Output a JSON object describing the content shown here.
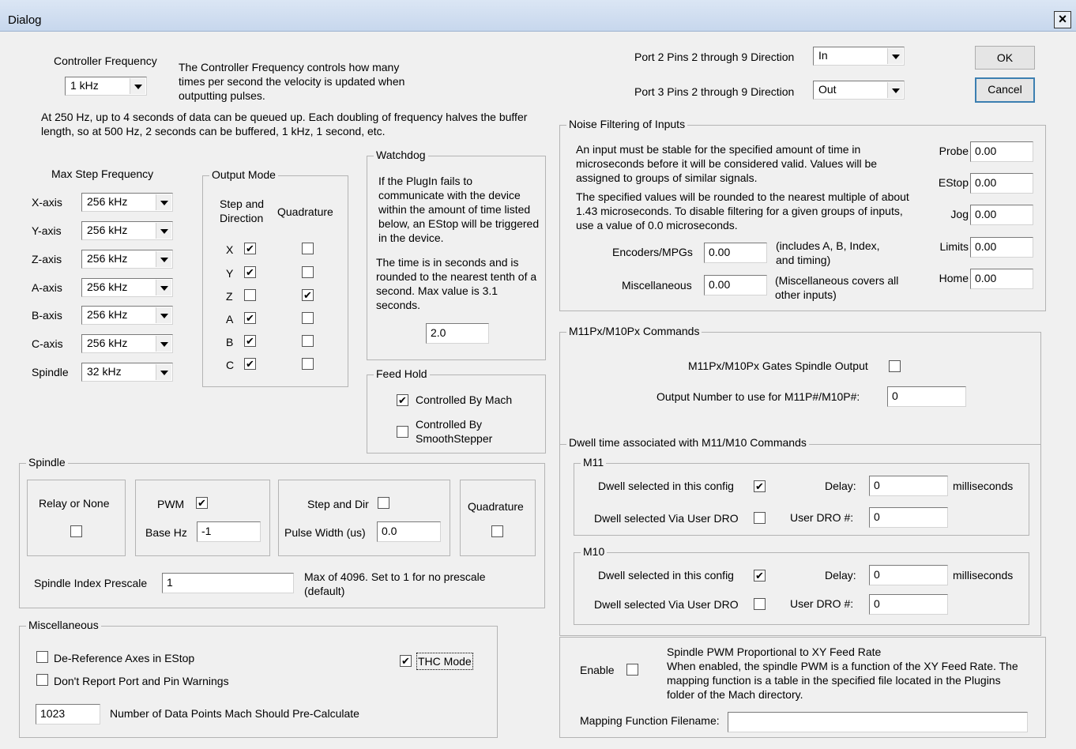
{
  "window": {
    "title": "Dialog",
    "close_glyph": "×"
  },
  "buttons": {
    "ok": "OK",
    "cancel": "Cancel"
  },
  "ports": {
    "port2_label": "Port 2 Pins 2 through 9 Direction",
    "port2_value": "In",
    "port3_label": "Port 3 Pins 2 through 9 Direction",
    "port3_value": "Out"
  },
  "controller": {
    "label": "Controller Frequency",
    "value": "1 kHz",
    "desc": "The Controller Frequency controls how many times per second the velocity is updated when outputting pulses.",
    "buffer_note": "At 250 Hz, up to 4 seconds of data can be queued up.  Each doubling of frequency halves the buffer length, so at 500 Hz, 2 seconds can be buffered, 1 kHz, 1 second, etc."
  },
  "max_step": {
    "label": "Max Step Frequency",
    "axes": [
      {
        "name": "X-axis",
        "value": "256 kHz"
      },
      {
        "name": "Y-axis",
        "value": "256 kHz"
      },
      {
        "name": "Z-axis",
        "value": "256 kHz"
      },
      {
        "name": "A-axis",
        "value": "256 kHz"
      },
      {
        "name": "B-axis",
        "value": "256 kHz"
      },
      {
        "name": "C-axis",
        "value": "256 kHz"
      },
      {
        "name": "Spindle",
        "value": "32 kHz"
      }
    ]
  },
  "output_mode": {
    "title": "Output Mode",
    "step_dir_label": "Step and Direction",
    "quadrature_label": "Quadrature",
    "rows": [
      {
        "axis": "X",
        "step": "✔",
        "quad": ""
      },
      {
        "axis": "Y",
        "step": "✔",
        "quad": ""
      },
      {
        "axis": "Z",
        "step": "",
        "quad": "✔"
      },
      {
        "axis": "A",
        "step": "✔",
        "quad": ""
      },
      {
        "axis": "B",
        "step": "✔",
        "quad": ""
      },
      {
        "axis": "C",
        "step": "✔",
        "quad": ""
      }
    ]
  },
  "watchdog": {
    "title": "Watchdog",
    "desc1": "If the PlugIn fails to communicate with the device within the amount of time listed below, an EStop will be triggered in the device.",
    "desc2": "The time is in seconds and is rounded to the nearest tenth of a second.  Max value is 3.1 seconds.",
    "value": "2.0"
  },
  "feed_hold": {
    "title": "Feed Hold",
    "mach_label": "Controlled By Mach",
    "mach_checked": "✔",
    "ss_label": "Controlled By SmoothStepper",
    "ss_checked": ""
  },
  "noise": {
    "title": "Noise Filtering of Inputs",
    "desc1": "An input must be stable for the specified amount of time in microseconds before it will be considered valid.  Values will be assigned to groups of similar signals.",
    "desc2": "The specified values will be rounded to the nearest multiple of about 1.43 microseconds.  To disable filtering for a given groups of inputs, use a value of 0.0 microseconds.",
    "encoders_label": "Encoders/MPGs",
    "encoders_value": "0.00",
    "encoders_note": "(includes A, B, Index, and timing)",
    "misc_label": "Miscellaneous",
    "misc_value": "0.00",
    "misc_note": "(Miscellaneous covers all other inputs)",
    "right": [
      {
        "label": "Probe",
        "value": "0.00"
      },
      {
        "label": "EStop",
        "value": "0.00"
      },
      {
        "label": "Jog",
        "value": "0.00"
      },
      {
        "label": "Limits",
        "value": "0.00"
      },
      {
        "label": "Home",
        "value": "0.00"
      }
    ]
  },
  "m11": {
    "title": "M11Px/M10Px Commands",
    "gates_label": "M11Px/M10Px Gates Spindle Output",
    "gates_checked": "",
    "output_label": "Output Number to use for M11P#/M10P#:",
    "output_value": "0"
  },
  "dwell": {
    "title": "Dwell time associated with M11/M10 Commands",
    "groups": [
      {
        "name": "M11",
        "config_label": "Dwell selected in this config",
        "config_checked": "✔",
        "delay_label": "Delay:",
        "delay_value": "0",
        "ms_label": "milliseconds",
        "user_label": "Dwell selected Via User DRO",
        "user_checked": "",
        "dro_label": "User DRO #:",
        "dro_value": "0"
      },
      {
        "name": "M10",
        "config_label": "Dwell selected in this config",
        "config_checked": "✔",
        "delay_label": "Delay:",
        "delay_value": "0",
        "ms_label": "milliseconds",
        "user_label": "Dwell selected Via User DRO",
        "user_checked": "",
        "dro_label": "User DRO #:",
        "dro_value": "0"
      }
    ]
  },
  "spindle": {
    "title": "Spindle",
    "relay_label": "Relay or None",
    "relay_checked": "",
    "pwm_label": "PWM",
    "pwm_checked": "✔",
    "base_hz_label": "Base Hz",
    "base_hz_value": "-1",
    "stepdir_label": "Step and Dir",
    "stepdir_checked": "",
    "pulse_label": "Pulse Width (us)",
    "pulse_value": "0.0",
    "quad_label": "Quadrature",
    "quad_checked": "",
    "prescale_label": "Spindle Index Prescale",
    "prescale_value": "1",
    "prescale_note": "Max of 4096. Set to 1 for no prescale (default)"
  },
  "misc": {
    "title": "Miscellaneous",
    "deref_label": "De-Reference Axes in EStop",
    "deref_checked": "",
    "nowarn_label": "Don't Report Port and Pin Warnings",
    "nowarn_checked": "",
    "thc_label": "THC Mode",
    "thc_checked": "✔",
    "points_value": "1023",
    "points_label": "Number of Data Points Mach Should Pre-Calculate"
  },
  "pwm_feed": {
    "enable_label": "Enable",
    "enable_checked": "",
    "title": "Spindle PWM Proportional to XY Feed Rate",
    "desc": "When enabled, the spindle PWM is a function of the XY Feed Rate. The mapping function is a table in the specified file located in the Plugins folder of the Mach directory.",
    "filename_label": "Mapping Function Filename:",
    "filename_value": ""
  }
}
